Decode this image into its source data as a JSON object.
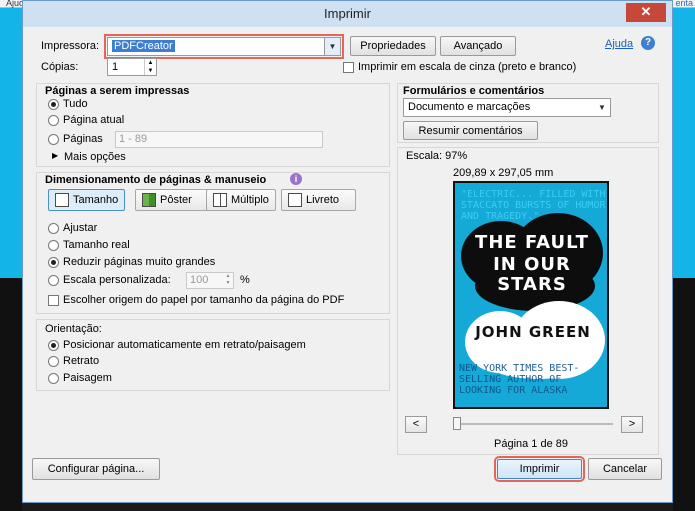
{
  "background": {
    "left_text": "Ajuda",
    "right_text": "enta"
  },
  "dialog": {
    "title": "Imprimir",
    "close_icon": "close-icon",
    "help_link": "Ajuda",
    "help_icon": "help-icon"
  },
  "printer": {
    "label": "Impressora:",
    "selected": "PDFCreator",
    "properties_button": "Propriedades",
    "advanced_button": "Avançado",
    "copies_label": "Cópias:",
    "copies_value": "1",
    "grayscale_label": "Imprimir em escala de cinza (preto e branco)",
    "grayscale_checked": false
  },
  "pages": {
    "heading": "Páginas a serem impressas",
    "options": [
      "Tudo",
      "Página atual",
      "Páginas"
    ],
    "selected_index": 0,
    "range_placeholder": "1 - 89",
    "more_options": "Mais opções"
  },
  "sizing": {
    "heading": "Dimensionamento de páginas & manuseio",
    "info_icon": "info-icon",
    "modes": [
      {
        "label": "Tamanho",
        "icon": "size-icon"
      },
      {
        "label": "Pôster",
        "icon": "poster-icon"
      },
      {
        "label": "Múltiplo",
        "icon": "multiple-icon"
      },
      {
        "label": "Livreto",
        "icon": "booklet-icon"
      }
    ],
    "active_mode": 0,
    "options": [
      "Ajustar",
      "Tamanho real",
      "Reduzir páginas muito grandes",
      "Escala personalizada:"
    ],
    "selected_index": 2,
    "scale_value": "100",
    "scale_unit": "%",
    "paper_source_label": "Escolher origem do papel por tamanho da página do PDF"
  },
  "orientation": {
    "heading": "Orientação:",
    "options": [
      "Posicionar automaticamente em retrato/paisagem",
      "Retrato",
      "Paisagem"
    ],
    "selected_index": 0
  },
  "forms": {
    "heading": "Formulários e comentários",
    "selected": "Documento e marcações",
    "summarize_button": "Resumir comentários"
  },
  "preview": {
    "scale_label": "Escala:  97%",
    "dimensions": "209,89 x 297,05 mm",
    "cover_title_line1": "THE FAULT",
    "cover_title_line2": "IN OUR STARS",
    "cover_author": "JOHN GREEN",
    "cover_blurb_top": "\"ELECTRIC... FILLED WITH STACCATO BURSTS OF HUMOR AND TRAGEDY.\"",
    "cover_blurb_bottom": "NEW YORK TIMES BEST-SELLING AUTHOR OF LOOKING FOR ALASKA",
    "prev_button": "<",
    "next_button": ">",
    "page_indicator": "Página 1 de 89"
  },
  "footer": {
    "page_setup_button": "Configurar página...",
    "print_button": "Imprimir",
    "cancel_button": "Cancelar"
  }
}
